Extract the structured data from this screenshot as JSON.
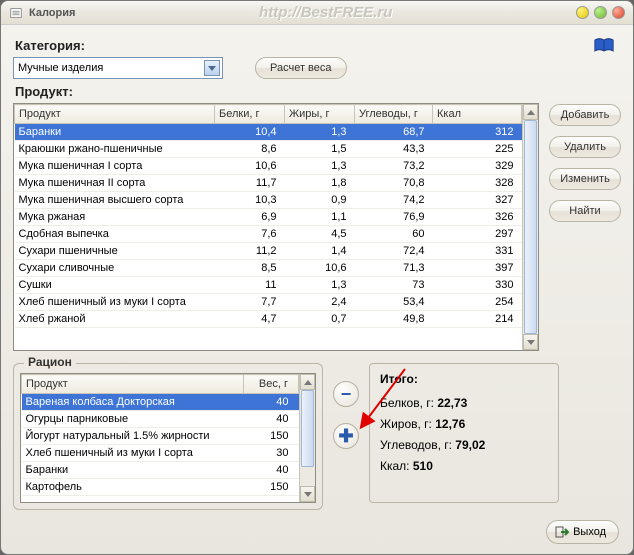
{
  "titlebar": {
    "title": "Калория",
    "url": "http://BestFREE.ru"
  },
  "category": {
    "label": "Категория:",
    "value": "Мучные изделия"
  },
  "buttons": {
    "calc": "Расчет веса",
    "add": "Добавить",
    "del": "Удалить",
    "edit": "Изменить",
    "find": "Найти",
    "exit": "Выход"
  },
  "product_section_label": "Продукт:",
  "product_table": {
    "headers": [
      "Продукт",
      "Белки, г",
      "Жиры, г",
      "Углеводы, г",
      "Ккал"
    ],
    "rows": [
      {
        "name": "Баранки",
        "p": "10,4",
        "f": "1,3",
        "c": "68,7",
        "k": "312",
        "sel": true
      },
      {
        "name": "Краюшки ржано-пшеничные",
        "p": "8,6",
        "f": "1,5",
        "c": "43,3",
        "k": "225"
      },
      {
        "name": "Мука пшеничная I сорта",
        "p": "10,6",
        "f": "1,3",
        "c": "73,2",
        "k": "329"
      },
      {
        "name": "Мука пшеничная II сорта",
        "p": "11,7",
        "f": "1,8",
        "c": "70,8",
        "k": "328"
      },
      {
        "name": "Мука пшеничная высшего сорта",
        "p": "10,3",
        "f": "0,9",
        "c": "74,2",
        "k": "327"
      },
      {
        "name": "Мука ржаная",
        "p": "6,9",
        "f": "1,1",
        "c": "76,9",
        "k": "326"
      },
      {
        "name": "Сдобная выпечка",
        "p": "7,6",
        "f": "4,5",
        "c": "60",
        "k": "297"
      },
      {
        "name": "Сухари пшеничные",
        "p": "11,2",
        "f": "1,4",
        "c": "72,4",
        "k": "331"
      },
      {
        "name": "Сухари сливочные",
        "p": "8,5",
        "f": "10,6",
        "c": "71,3",
        "k": "397"
      },
      {
        "name": "Сушки",
        "p": "11",
        "f": "1,3",
        "c": "73",
        "k": "330"
      },
      {
        "name": "Хлеб пшеничный из муки I сорта",
        "p": "7,7",
        "f": "2,4",
        "c": "53,4",
        "k": "254"
      },
      {
        "name": "Хлеб ржаной",
        "p": "4,7",
        "f": "0,7",
        "c": "49,8",
        "k": "214"
      }
    ]
  },
  "ration": {
    "title": "Рацион",
    "headers": [
      "Продукт",
      "Вес, г"
    ],
    "rows": [
      {
        "name": "Вареная колбаса Докторская",
        "w": "40",
        "sel": true
      },
      {
        "name": "Огурцы парниковые",
        "w": "40"
      },
      {
        "name": "Йогурт натуральный 1.5% жирности",
        "w": "150"
      },
      {
        "name": "Хлеб пшеничный из муки I сорта",
        "w": "30"
      },
      {
        "name": "Баранки",
        "w": "40"
      },
      {
        "name": "Картофель",
        "w": "150"
      }
    ]
  },
  "totals": {
    "title": "Итого:",
    "p_label": "Белков, г:",
    "p_val": "22,73",
    "f_label": "Жиров, г:",
    "f_val": "12,76",
    "c_label": "Углеводов, г:",
    "c_val": "79,02",
    "k_label": "Ккал:",
    "k_val": "510"
  }
}
